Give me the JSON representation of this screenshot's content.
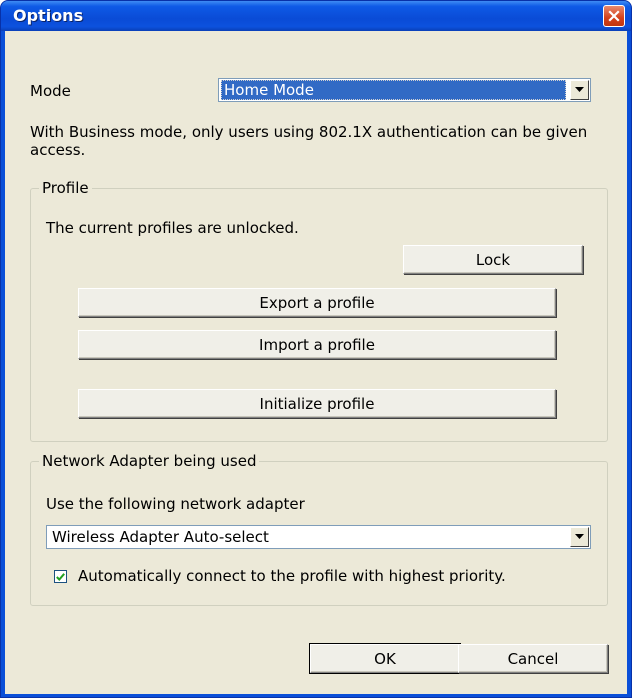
{
  "window": {
    "title": "Options"
  },
  "mode": {
    "label": "Mode",
    "selected": "Home Mode",
    "description": "With Business mode, only users using 802.1X authentication can be given access."
  },
  "profile": {
    "group_label": "Profile",
    "status": "The current profiles are unlocked.",
    "lock_label": "Lock",
    "export_label": "Export a profile",
    "import_label": "Import a profile",
    "initialize_label": "Initialize profile"
  },
  "adapter": {
    "group_label": "Network Adapter being used",
    "instruction": "Use the following network adapter",
    "selected": "Wireless Adapter Auto-select",
    "auto_connect_label": "Automatically connect to the profile with highest priority.",
    "auto_connect_checked": true
  },
  "footer": {
    "ok_label": "OK",
    "cancel_label": "Cancel"
  },
  "icons": {
    "close": "close-icon",
    "dropdown": "chevron-down-icon",
    "check": "check-icon"
  }
}
